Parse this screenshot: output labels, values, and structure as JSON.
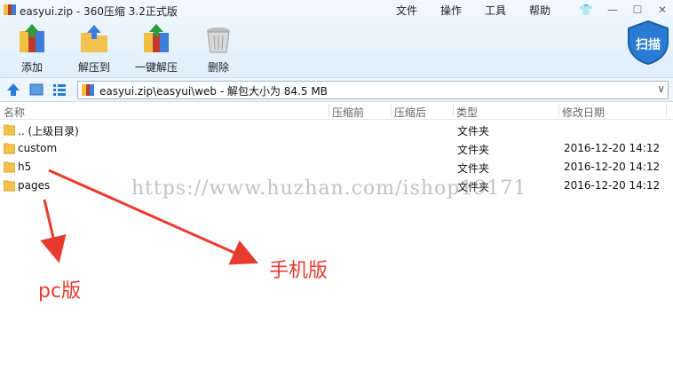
{
  "window": {
    "title": "easyui.zip - 360压缩 3.2正式版",
    "menus": [
      "文件",
      "操作",
      "工具",
      "帮助"
    ]
  },
  "toolbar": {
    "add": "添加",
    "extract_to": "解压到",
    "one_click_extract": "一键解压",
    "delete": "删除",
    "scan": "扫描"
  },
  "address": {
    "path": "easyui.zip\\easyui\\web - 解包大小为 84.5 MB"
  },
  "columns": {
    "name": "名称",
    "compressed": "压缩前",
    "uncompressed": "压缩后",
    "type": "类型",
    "modified": "修改日期"
  },
  "files": [
    {
      "name": ".. (上级目录)",
      "type": "文件夹",
      "modified": ""
    },
    {
      "name": "custom",
      "type": "文件夹",
      "modified": "2016-12-20 14:12"
    },
    {
      "name": "h5",
      "type": "文件夹",
      "modified": "2016-12-20 14:12"
    },
    {
      "name": "pages",
      "type": "文件夹",
      "modified": "2016-12-20 14:12"
    }
  ],
  "watermark": "https://www.huzhan.com/ishop19171",
  "annotations": {
    "pc": "pc版",
    "mobile": "手机版"
  },
  "colors": {
    "accent_blue": "#2a7bd3",
    "annotation_red": "#e83b30",
    "folder_yellow": "#f2c14e"
  }
}
